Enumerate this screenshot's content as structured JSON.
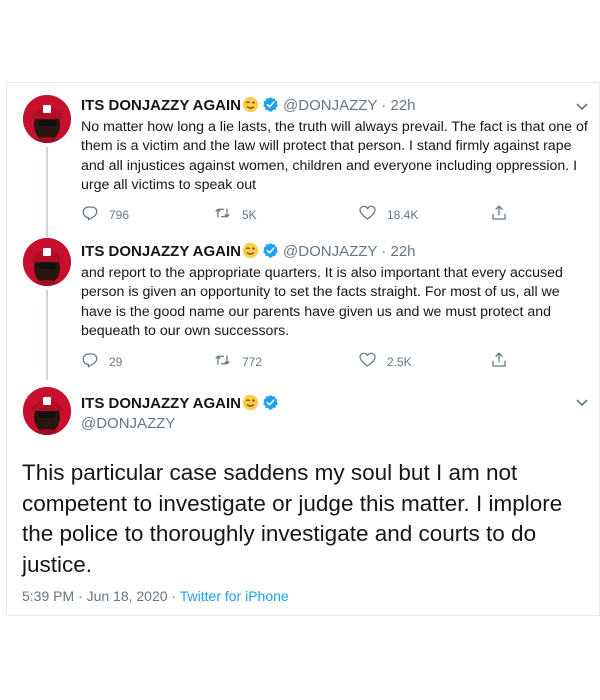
{
  "colors": {
    "brand_blue": "#1da1f2",
    "verified_blue": "#1da1f2",
    "avatar_red": "#c8102e",
    "secondary_text": "#657786",
    "thread_line": "#ccd6dd"
  },
  "tweets": [
    {
      "name": "ITS DONJAZZY AGAIN",
      "handle": "@DONJAZZY",
      "time": "22h",
      "text": "No matter how long a lie lasts, the truth will always prevail. The fact is that one of them is a victim and the law will protect that person. I stand firmly against rape and all injustices against women, children and everyone including oppression. I urge all victims to speak out",
      "replies": "796",
      "retweets": "5K",
      "likes": "18.4K"
    },
    {
      "name": "ITS DONJAZZY AGAIN",
      "handle": "@DONJAZZY",
      "time": "22h",
      "text": "and report to the appropriate quarters. It is also important that every accused person is given an opportunity to set the facts straight. For most of us, all we have is the good name our parents have given us and we must protect and bequeath to our own successors.",
      "replies": "29",
      "retweets": "772",
      "likes": "2.5K"
    }
  ],
  "main_tweet": {
    "name": "ITS DONJAZZY AGAIN",
    "handle": "@DONJAZZY",
    "text": "This particular case saddens my soul but I am not competent to investigate or judge this matter. I implore the police to thoroughly investigate and courts to do justice.",
    "timestamp": "5:39 PM · Jun 18, 2020",
    "separator": " · ",
    "source": "Twitter for iPhone"
  },
  "icons": {
    "emoji": "winking-face-emoji",
    "verified": "verified-badge-icon",
    "caret": "chevron-down-icon",
    "reply": "reply-icon",
    "retweet": "retweet-icon",
    "like": "heart-icon",
    "share": "share-icon"
  }
}
